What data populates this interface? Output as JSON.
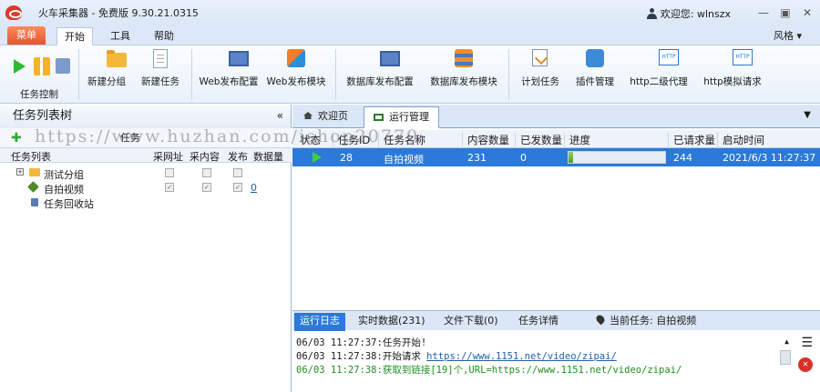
{
  "window": {
    "title": "火车采集器 - 免费版 9.30.21.0315",
    "user_label": "欢迎您: wlnszx"
  },
  "menu": {
    "main": "菜单",
    "tabs": [
      "开始",
      "工具",
      "帮助"
    ],
    "style": "风格"
  },
  "ribbon": {
    "control_label": "任务控制",
    "buttons": [
      "新建分组",
      "新建任务",
      "Web发布配置",
      "Web发布模块",
      "数据库发布配置",
      "数据库发布模块",
      "计划任务",
      "插件管理",
      "http二级代理",
      "http模拟请求"
    ]
  },
  "left": {
    "title": "任务列表树",
    "collapse": "«",
    "field_label": "任务",
    "headers": [
      "任务列表",
      "采网址",
      "采内容",
      "发布",
      "数据量"
    ],
    "tree": [
      {
        "label": "测试分组",
        "expand": "+"
      },
      {
        "label": "自拍视频",
        "count": "0"
      },
      {
        "label": "任务回收站"
      }
    ]
  },
  "watermark": "https://www.huzhan.com/ishop20770",
  "right": {
    "tabs": [
      "欢迎页",
      "运行管理"
    ],
    "columns": [
      "状态",
      "任务ID",
      "任务名称",
      "内容数量",
      "已发数量",
      "进度",
      "已请求量",
      "启动时间"
    ],
    "rows": [
      {
        "id": "28",
        "name": "自拍视频",
        "content_count": "231",
        "sent": "0",
        "progress": 0.05,
        "requested": "244",
        "start_time": "2021/6/3 11:27:37"
      }
    ],
    "log_tabs": [
      "运行日志",
      "实时数据(231)",
      "文件下载(0)",
      "任务详情"
    ],
    "current_task": "当前任务: 自拍视频",
    "log": [
      {
        "time": "06/03 11:27:37:",
        "text": "任务开始!",
        "link": ""
      },
      {
        "time": "06/03 11:27:38:",
        "text": "开始请求 ",
        "link": "https://www.1151.net/video/zipai/"
      },
      {
        "time": "06/03 11:27:38:",
        "text": "获取到链接[19]个,URL=https://www.1151.net/video/zipai/",
        "link": ""
      }
    ]
  }
}
